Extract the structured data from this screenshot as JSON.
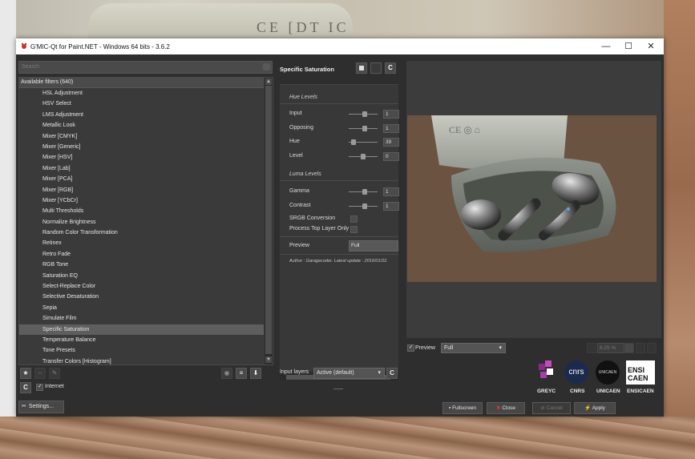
{
  "window": {
    "title": "G'MIC-Qt for Paint.NET - Windows 64 bits - 3.6.2",
    "controls": {
      "minimize": "—",
      "maximize": "☐",
      "close": "✕"
    }
  },
  "background": {
    "case_text": "CE [DT IC"
  },
  "filters": {
    "search_placeholder": "Search",
    "header": "Available filters (640)",
    "items": [
      "HSL Adjustment",
      "HSV Select",
      "LMS Adjustment",
      "Metallic Look",
      "Mixer [CMYK]",
      "Mixer [Generic]",
      "Mixer [HSV]",
      "Mixer [Lab]",
      "Mixer [PCA]",
      "Mixer [RGB]",
      "Mixer [YCbCr]",
      "Multi Thresholds",
      "Normalize Brightness",
      "Random Color Transformation",
      "Retinex",
      "Retro Fade",
      "RGB Tone",
      "Saturation EQ",
      "Select-Replace Color",
      "Selective Desaturation",
      "Sepia",
      "Simulate Film",
      "Specific Saturation",
      "Temperature Balance",
      "Tone Presets",
      "Transfer Colors [Histogram]"
    ],
    "selected": "Specific Saturation",
    "internet_label": "Internet",
    "settings_label": "Settings..."
  },
  "params": {
    "filter_name": "Specific Saturation",
    "hue_section": "Hue Levels",
    "hue": [
      {
        "label": "Input",
        "value": "1",
        "pos": 0.55
      },
      {
        "label": "Opposing",
        "value": "1",
        "pos": 0.55
      },
      {
        "label": "Hue",
        "value": "39",
        "pos": 0.1
      },
      {
        "label": "Level",
        "value": "0",
        "pos": 0.5
      }
    ],
    "luma_section": "Luma Levels",
    "luma": [
      {
        "label": "Gamma",
        "value": "1",
        "pos": 0.55
      },
      {
        "label": "Contrast",
        "value": "1",
        "pos": 0.55
      }
    ],
    "srgb_label": "SRGB Conversion",
    "top_layer_label": "Process Top Layer Only",
    "preview_label": "Preview",
    "preview_value": "Full",
    "author": "Author : Garagecoder. Latest update : 2016/01/22."
  },
  "input_layers": {
    "label": "Input layers",
    "value": "Active (default)"
  },
  "preview": {
    "label": "Preview",
    "mode": "Full",
    "zoom": "6.25 %"
  },
  "logos": {
    "greyc": "GREYC",
    "cnrs": "CNRS",
    "cnrs_mark": "cnrs",
    "unicaen": "UNICAEN",
    "unicaen_mark": "UNICAEN",
    "ensicaen": "ENSICAEN",
    "ensi_top": "ENSI",
    "ensi_bottom": "CAEN"
  },
  "buttons": {
    "fullscreen": "Fullscreen",
    "close": "Close",
    "cancel": "Cancel",
    "apply": "Apply"
  }
}
